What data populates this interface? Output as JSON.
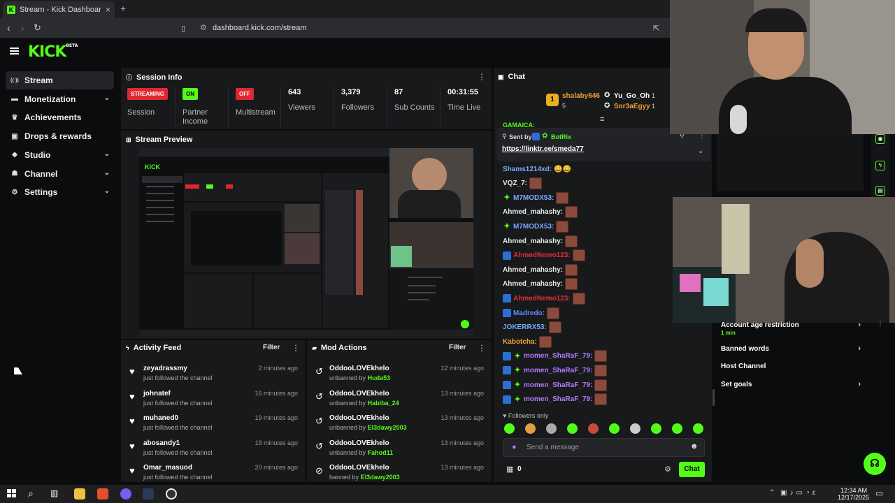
{
  "browser": {
    "tab_title": "Stream - Kick Dashboard",
    "tab_close": "×",
    "new_tab": "+",
    "url": "dashboard.kick.com/stream"
  },
  "app": {
    "logo": "KICK",
    "logo_sup": "BETA"
  },
  "sidebar": {
    "items": [
      {
        "label": "Stream",
        "icon": "stream-icon",
        "active": true
      },
      {
        "label": "Monetization",
        "icon": "monetization-icon",
        "has_chevron": true
      },
      {
        "label": "Achievements",
        "icon": "trophy-icon"
      },
      {
        "label": "Drops & rewards",
        "icon": "gift-icon"
      },
      {
        "label": "Studio",
        "icon": "studio-icon",
        "has_chevron": true
      },
      {
        "label": "Channel",
        "icon": "channel-icon",
        "has_chevron": true
      },
      {
        "label": "Settings",
        "icon": "gear-icon",
        "has_chevron": true
      }
    ]
  },
  "session_info": {
    "title": "Session Info",
    "streaming_badge": "STREAMING",
    "session_label": "Session",
    "on_badge": "ON",
    "partner_label": "Partner Income",
    "off_badge": "OFF",
    "multistream_label": "Multistream",
    "viewers": "643",
    "viewers_label": "Viewers",
    "followers": "3,379",
    "followers_label": "Followers",
    "sub_counts": "87",
    "sub_counts_label": "Sub Counts",
    "time_live": "00:31:55",
    "time_live_label": "Time Live"
  },
  "stream_preview": {
    "title": "Stream Preview"
  },
  "activity_feed": {
    "title": "Activity Feed",
    "filter": "Filter",
    "rows": [
      {
        "name": "zeyadrassmy",
        "action": "just followed the channel",
        "time": "2 minutes ago"
      },
      {
        "name": "johnatef",
        "action": "just followed the channel",
        "time": "16 minutes ago"
      },
      {
        "name": "muhaned0",
        "action": "just followed the channel",
        "time": "19 minutes ago"
      },
      {
        "name": "abosandy1",
        "action": "just followed the channel",
        "time": "19 minutes ago"
      },
      {
        "name": "Omar_masuod",
        "action": "just followed the channel",
        "time": "20 minutes ago"
      }
    ]
  },
  "mod_actions": {
    "title": "Mod Actions",
    "filter": "Filter",
    "rows": [
      {
        "mod": "OddooLOVEkhelo",
        "verb": "unbanned by",
        "target": "Huda53",
        "time": "12 minutes ago"
      },
      {
        "mod": "OddooLOVEkhelo",
        "verb": "unbanned by",
        "target": "Habiba_24",
        "time": "13 minutes ago"
      },
      {
        "mod": "OddooLOVEkhelo",
        "verb": "unbanned by",
        "target": "El3dawy2003",
        "time": "13 minutes ago"
      },
      {
        "mod": "OddooLOVEkhelo",
        "verb": "unbanned by",
        "target": "Fahod11",
        "time": "13 minutes ago"
      },
      {
        "mod": "OddooLOVEkhelo",
        "verb": "banned by",
        "target": "El3dawy2003",
        "time": "13 minutes ago"
      }
    ]
  },
  "chat": {
    "title": "Chat",
    "top_gifters": [
      {
        "name": "shalaby646",
        "count": "5"
      },
      {
        "name": "Yu_Go_Oh",
        "count": "1"
      },
      {
        "name": "Sor3aEgyy",
        "count": "1"
      }
    ],
    "rank_badge": "1",
    "pinned_partial": "GAMAICA:",
    "pinned_sent_by": "Sent by",
    "pinned_author": "BotRix",
    "pinned_link": "https://linktr.ee/smeda77",
    "messages": [
      {
        "user": "Shams1214xd:",
        "color": "#7aa8ff",
        "content": "😀😀",
        "emotes": 0,
        "badges": 0
      },
      {
        "user": "VQZ_7:",
        "color": "#e8e8e8",
        "content": "",
        "emotes": 1,
        "badges": 0
      },
      {
        "user": "M7MODX53:",
        "color": "#7aa8ff",
        "content": "",
        "emotes": 1,
        "badges": 1
      },
      {
        "user": "Ahmed_mahashy:",
        "color": "#e8e8e8",
        "content": "",
        "emotes": 1,
        "badges": 0
      },
      {
        "user": "M7MODX53:",
        "color": "#7aa8ff",
        "content": "",
        "emotes": 1,
        "badges": 1
      },
      {
        "user": "Ahmed_mahashy:",
        "color": "#e8e8e8",
        "content": "",
        "emotes": 1,
        "badges": 0
      },
      {
        "user": "AhmedNemo123:",
        "color": "#e0303a",
        "content": "",
        "emotes": 1,
        "badges": 2
      },
      {
        "user": "Ahmed_mahashy:",
        "color": "#e8e8e8",
        "content": "",
        "emotes": 1,
        "badges": 0
      },
      {
        "user": "Ahmed_mahashy:",
        "color": "#e8e8e8",
        "content": "",
        "emotes": 1,
        "badges": 0
      },
      {
        "user": "AhmedNemo123:",
        "color": "#e0303a",
        "content": "",
        "emotes": 1,
        "badges": 2
      },
      {
        "user": "Madredo:",
        "color": "#5b8cff",
        "content": "",
        "emotes": 1,
        "badges": 2
      },
      {
        "user": "JOKERRX53:",
        "color": "#7aa8ff",
        "content": "",
        "emotes": 1,
        "badges": 0
      },
      {
        "user": "Kabotcha:",
        "color": "#f0a030",
        "content": "",
        "emotes": 1,
        "badges": 0
      },
      {
        "user": "momen_ShaRaF_79:",
        "color": "#b07cff",
        "content": "",
        "emotes": 1,
        "badges": 3
      },
      {
        "user": "momen_ShaRaF_79:",
        "color": "#b07cff",
        "content": "",
        "emotes": 1,
        "badges": 3
      },
      {
        "user": "momen_ShaRaF_79:",
        "color": "#b07cff",
        "content": "",
        "emotes": 1,
        "badges": 3
      },
      {
        "user": "momen_ShaRaF_79:",
        "color": "#b07cff",
        "content": "",
        "emotes": 1,
        "badges": 3
      }
    ],
    "followers_only": "Followers only",
    "input_placeholder": "Send a message",
    "viewer_count": "0",
    "send_button": "Chat"
  },
  "channel_settings": {
    "items": [
      {
        "label": "Account age restriction",
        "sub": "1 min",
        "chevron": true
      },
      {
        "label": "Banned words",
        "chevron": true
      },
      {
        "label": "Host Channel",
        "chevron": false
      },
      {
        "label": "Set goals",
        "chevron": true
      }
    ]
  },
  "taskbar": {
    "time": "12:34 AM",
    "date": "12/17/2025"
  },
  "colors": {
    "brand": "#53fc18",
    "streaming": "#e0262f",
    "panel": "#18191b",
    "background": "#0b0c0d"
  }
}
